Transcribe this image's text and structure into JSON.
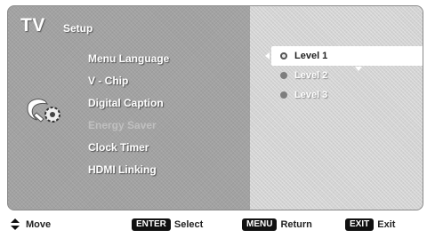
{
  "header": {
    "logo": "TV",
    "title": "Setup"
  },
  "menu": {
    "items": [
      {
        "label": "Menu Language",
        "enabled": true
      },
      {
        "label": "V - Chip",
        "enabled": true
      },
      {
        "label": "Digital Caption",
        "enabled": true
      },
      {
        "label": "Energy Saver",
        "enabled": false
      },
      {
        "label": "Clock Timer",
        "enabled": true
      },
      {
        "label": "HDMI Linking",
        "enabled": true
      }
    ],
    "icon": "setup-gear-icon"
  },
  "options": {
    "items": [
      {
        "label": "Level 1",
        "selected": true
      },
      {
        "label": "Level 2",
        "selected": false
      },
      {
        "label": "Level 3",
        "selected": false
      }
    ]
  },
  "footer": {
    "move": {
      "icon": "up-down-arrows-icon",
      "label": "Move"
    },
    "select": {
      "key": "ENTER",
      "label": "Select"
    },
    "return": {
      "key": "MENU",
      "label": "Return"
    },
    "exit": {
      "key": "EXIT",
      "label": "Exit"
    }
  },
  "colors": {
    "panel_bg": "#a2a2a2",
    "options_bg": "#d3d3d3",
    "highlight": "#ffffff",
    "text": "#ffffff",
    "key_bg": "#111111"
  }
}
